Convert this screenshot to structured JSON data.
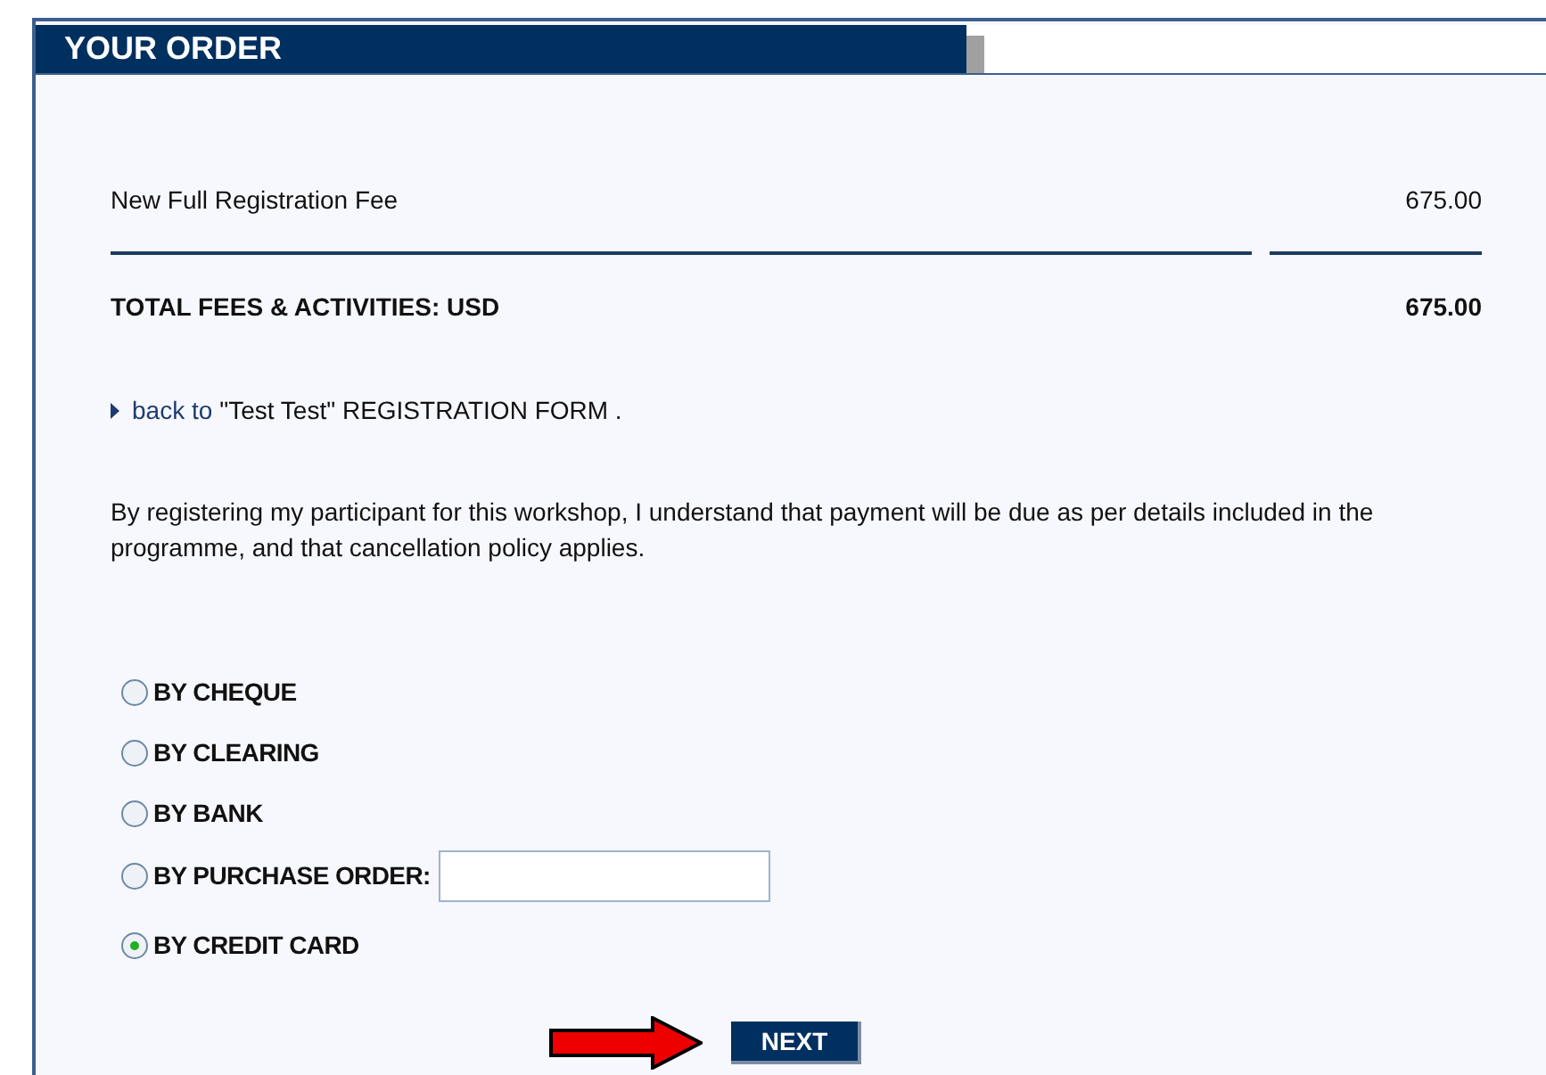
{
  "header": {
    "title": "YOUR ORDER"
  },
  "fees": [
    {
      "label": "New Full Registration Fee",
      "amount": "675.00"
    }
  ],
  "total": {
    "label": "TOTAL FEES & ACTIVITIES: USD",
    "amount": "675.00"
  },
  "back": {
    "link": "back to",
    "text": "\"Test Test\" REGISTRATION FORM ."
  },
  "notice": "By registering my participant for this workshop, I understand that payment will be due as per details included in the programme, and that cancellation policy applies.",
  "payment_options": [
    {
      "kind": "radio",
      "label": "BY CHEQUE",
      "selected": false
    },
    {
      "kind": "radio",
      "label": "BY CLEARING",
      "selected": false
    },
    {
      "kind": "radio",
      "label": "BY BANK",
      "selected": false
    },
    {
      "kind": "radio_field",
      "label": "BY PURCHASE ORDER:",
      "selected": false
    },
    {
      "kind": "radio",
      "label": "BY CREDIT CARD",
      "selected": true
    }
  ],
  "next_button": "NEXT"
}
